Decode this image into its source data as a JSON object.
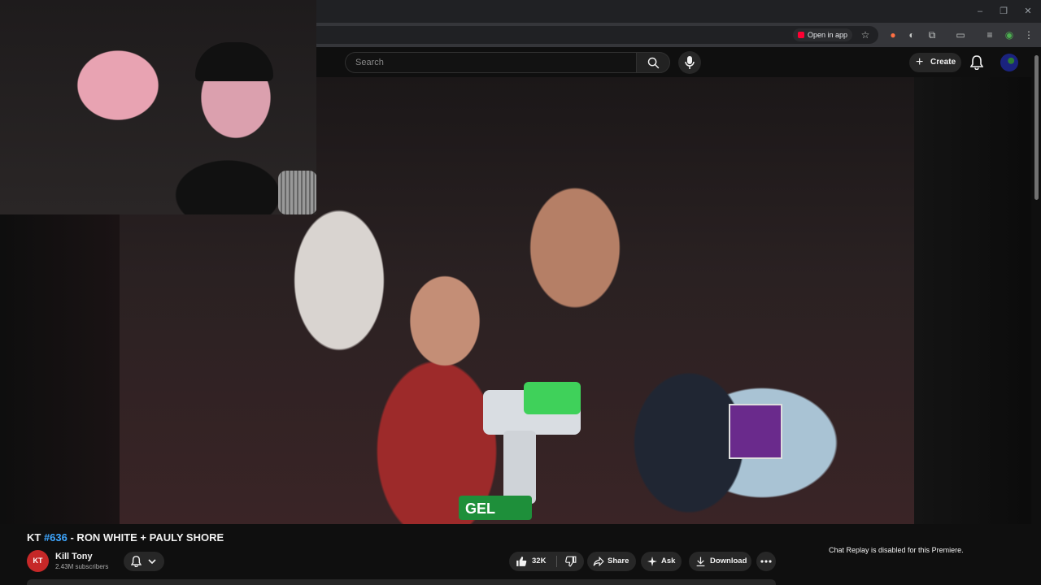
{
  "browser": {
    "open_in_app_label": "Open in app",
    "window_controls": [
      "–",
      "❐",
      "✕"
    ],
    "toolbar_icons": [
      "star-icon",
      "extension-icon",
      "puzzle-icon",
      "cast-icon",
      "media-icon",
      "profile-icon",
      "menu-icon"
    ]
  },
  "masthead": {
    "search_placeholder": "Search",
    "create_label": "Create"
  },
  "video": {
    "title_prefix": "KT ",
    "title_hashtag": "#636",
    "title_suffix": " - RON WHITE + PAULY SHORE",
    "tablet_sticker_text": "",
    "blaster_label": "GEL"
  },
  "channel": {
    "avatar_text": "KT",
    "name": "Kill Tony",
    "subscribers": "2.43M subscribers"
  },
  "actions": {
    "like_count": "32K",
    "share_label": "Share",
    "ask_label": "Ask",
    "download_label": "Download"
  },
  "chat": {
    "replay_note": "Chat Replay is disabled for this Premiere."
  },
  "colors": {
    "background": "#0f0f0f",
    "hashtag": "#3ea6ff",
    "pill": "#272727",
    "brand_red": "#ff0033"
  }
}
